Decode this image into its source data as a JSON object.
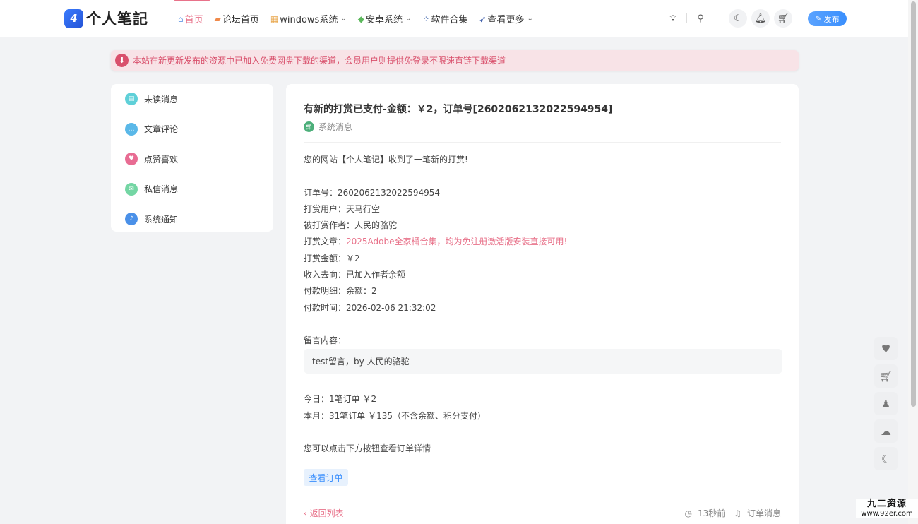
{
  "header": {
    "logo_text": "个人笔記",
    "nav": [
      {
        "label": "首页",
        "icon": "home-icon",
        "active": true,
        "has_dropdown": false
      },
      {
        "label": "论坛首页",
        "icon": "forum-icon",
        "active": false,
        "has_dropdown": false
      },
      {
        "label": "windows系统",
        "icon": "windows-icon",
        "active": false,
        "has_dropdown": true
      },
      {
        "label": "安卓系统",
        "icon": "android-icon",
        "active": false,
        "has_dropdown": true
      },
      {
        "label": "软件合集",
        "icon": "apps-icon",
        "active": false,
        "has_dropdown": false
      },
      {
        "label": "查看更多",
        "icon": "more-icon",
        "active": false,
        "has_dropdown": true
      }
    ],
    "publish_label": "发布"
  },
  "notice": {
    "text": "本站在新更新发布的资源中已加入免费网盘下载的渠道，会员用户则提供免登录不限速直链下载渠道"
  },
  "sidebar": {
    "items": [
      {
        "label": "未读消息",
        "icon": "unread-message-icon",
        "color": "#5fd0d8"
      },
      {
        "label": "文章评论",
        "icon": "comment-icon",
        "color": "#5ab8e8"
      },
      {
        "label": "点赞喜欢",
        "icon": "heart-icon",
        "color": "#e86c93"
      },
      {
        "label": "私信消息",
        "icon": "private-message-icon",
        "color": "#74d6a4"
      },
      {
        "label": "系统通知",
        "icon": "bell-icon",
        "color": "#4a90e8"
      }
    ]
  },
  "message": {
    "title": "有新的打赏已支付-金额：￥2，订单号[2602062132022594954]",
    "category": "系统消息",
    "intro": "您的网站【个人笔记】收到了一笔新的打赏!",
    "order_no": "订单号：2602062132022594954",
    "user": "打赏用户：天马行空",
    "author": "被打赏作者：人民的骆驼",
    "article_prefix": "打赏文章：",
    "article_link": "2025Adobe全家桶合集，均为免注册激活版安装直接可用!",
    "amount": "打赏金额：￥2",
    "income": "收入去向：已加入作者余额",
    "payment_detail": "付款明细：余额：2",
    "pay_time": "付款时间：2026-02-06 21:32:02",
    "comment_label": "留言内容：",
    "comment": "test留言，by 人民的骆驼",
    "today": "今日：1笔订单 ￥2",
    "month": "本月：31笔订单 ￥135（不含余额、积分支付）",
    "hint": "您可以点击下方按钮查看订单详情",
    "order_button": "查看订单",
    "back_link": "‹ 返回列表",
    "time_ago": "13秒前",
    "type": "订单消息"
  },
  "float_bar": [
    "heart-icon",
    "cart-icon",
    "qq-icon",
    "wechat-icon",
    "moon-icon"
  ],
  "watermark": {
    "line1": "九二资源",
    "line2": "www.92er.com"
  }
}
